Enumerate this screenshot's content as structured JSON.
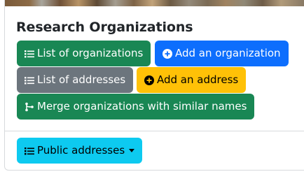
{
  "section": {
    "title": "Research Organizations"
  },
  "buttons": {
    "list_organizations": "List of organizations",
    "add_organization": "Add an organization",
    "list_addresses": "List of addresses",
    "add_address": "Add an address",
    "merge_organizations": "Merge organizations with similar names",
    "public_addresses": "Public addresses"
  },
  "colors": {
    "success": "#198754",
    "primary": "#0d6efd",
    "secondary": "#6c757d",
    "warning": "#ffc107",
    "info": "#0dcaf0"
  },
  "icons": {
    "list": "list-icon",
    "plus_circle": "plus-circle-icon",
    "merge": "merge-icon",
    "dropdown": "caret-down-icon"
  }
}
